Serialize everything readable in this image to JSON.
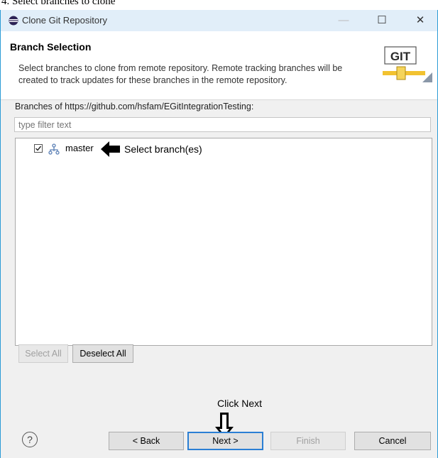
{
  "caption": "4. Select branches to clone",
  "window": {
    "title": "Clone Git Repository",
    "minimize": "—",
    "maximize": "☐",
    "close": "✕"
  },
  "banner": {
    "heading": "Branch Selection",
    "description": "Select branches to clone from remote repository. Remote tracking branches will be created to track updates for these branches in the remote repository.",
    "logo_text": "GIT"
  },
  "branches_label": "Branches of https://github.com/hsfam/EGitIntegrationTesting:",
  "filter": {
    "placeholder": "type filter text",
    "value": ""
  },
  "branches": [
    {
      "name": "master",
      "checked": true
    }
  ],
  "annotations": {
    "select_branch": "Select branch(es)",
    "click_next": "Click Next"
  },
  "buttons": {
    "select_all": "Select All",
    "deselect_all": "Deselect All",
    "back": "< Back",
    "next": "Next >",
    "finish": "Finish",
    "cancel": "Cancel",
    "help": "?"
  },
  "colors": {
    "titlebar": "#e1eef9",
    "window_border": "#2b9bd6",
    "default_button_border": "#2b7fd4"
  }
}
